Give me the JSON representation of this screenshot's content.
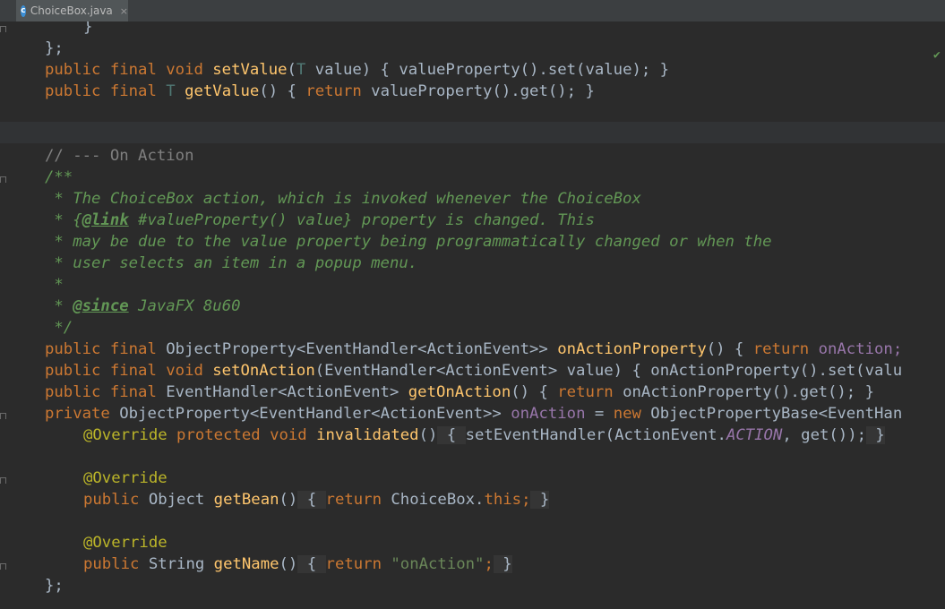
{
  "tab": {
    "filename": "ChoiceBox.java",
    "close": "×",
    "icon": "c-class-icon"
  },
  "colors": {
    "background": "#2b2b2b",
    "keyword": "#cc7832",
    "method": "#ffc66d",
    "doc_comment": "#629755",
    "annotation": "#bbb529",
    "string": "#6a8759",
    "field": "#9876aa"
  },
  "code": {
    "l1": {
      "a": "}"
    },
    "l2": {
      "a": "};"
    },
    "l3": {
      "a": "public final void",
      "b": " ",
      "c": "setValue",
      "d": "(",
      "e": "T",
      "f": " value) { valueProperty().set(value); }"
    },
    "l4": {
      "a": "public final",
      "b": " ",
      "c": "T",
      "d": " ",
      "e": "getValue",
      "f": "() { ",
      "g": "return",
      "h": " valueProperty().get(); }"
    },
    "l5": {
      "a": "// --- On Action"
    },
    "l6": {
      "a": "/**"
    },
    "l7": {
      "a": " * The ChoiceBox action, which is invoked whenever the ChoiceBox"
    },
    "l8": {
      "a": " * {",
      "b": "@link",
      "c": " #valueProperty() value} property is changed. This"
    },
    "l9": {
      "a": " * may be due to the value property being programmatically changed or when the"
    },
    "l10": {
      "a": " * user selects an item in a popup menu."
    },
    "l11": {
      "a": " *"
    },
    "l12": {
      "a": " * ",
      "b": "@since",
      "c": " JavaFX 8u60"
    },
    "l13": {
      "a": " */"
    },
    "l14": {
      "a": "public final",
      "b": " ObjectProperty<EventHandler<ActionEvent>> ",
      "c": "onActionProperty",
      "d": "() { ",
      "e": "return",
      "f": " ",
      "g": "onAction;"
    },
    "l15": {
      "a": "public final void",
      "b": " ",
      "c": "setOnAction",
      "d": "(EventHandler<ActionEvent> value) { onActionProperty().set(valu"
    },
    "l16": {
      "a": "public final",
      "b": " EventHandler<ActionEvent> ",
      "c": "getOnAction",
      "d": "() { ",
      "e": "return",
      "f": " onActionProperty().get(); }"
    },
    "l17": {
      "a": "private",
      "b": " ObjectProperty<EventHandler<ActionEvent>> ",
      "c": "onAction",
      "d": " = ",
      "e": "new",
      "f": " ObjectPropertyBase<EventHan"
    },
    "l18": {
      "a": "@Override",
      "b": " ",
      "c": "protected void",
      "d": " ",
      "e": "invalidated",
      "f": "()",
      "g": " { ",
      "h": "setEventHandler(ActionEvent.",
      "i": "ACTION",
      "j": ", get());",
      "k": " }"
    },
    "l19": {
      "a": "@Override"
    },
    "l20": {
      "a": "public",
      "b": " Object ",
      "c": "getBean",
      "d": "()",
      "e": " { ",
      "f": "return",
      "g": " ChoiceBox.",
      "h": "this",
      "i": ";",
      "j": " }"
    },
    "l21": {
      "a": "@Override"
    },
    "l22": {
      "a": "public",
      "b": " String ",
      "c": "getName",
      "d": "()",
      "e": " { ",
      "f": "return",
      "g": " ",
      "h": "\"onAction\"",
      "i": ";",
      "j": " }"
    },
    "l23": {
      "a": "};"
    }
  },
  "inspection_status": "ok-check-icon"
}
